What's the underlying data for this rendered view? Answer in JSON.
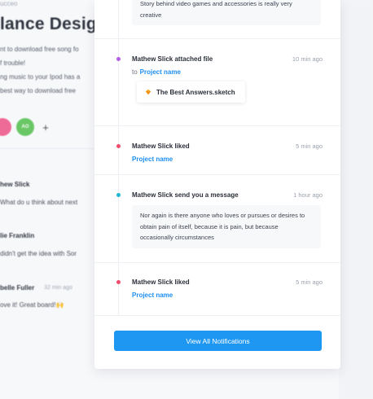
{
  "background_page": {
    "crumb": "ucceo",
    "title": "lance Design",
    "description_lines": [
      "nt to download free song fo",
      "f trouble!",
      "ng music to your Ipod has a",
      " best way to download free"
    ],
    "avatar_initials": "AO",
    "comments": [
      {
        "name": "hew Slick",
        "time": "",
        "text": "What do u think about next"
      },
      {
        "name": "lie Franklin",
        "time": "",
        "text": "didn't get the idea with Sor"
      },
      {
        "name": "belle Fuller",
        "time": "32 min ago",
        "text": "ove it! Great board!🙌"
      }
    ]
  },
  "notifications": {
    "top_quote": "Story behind video games and accessories is really very creative",
    "items": [
      {
        "title": "Mathew Slick attached file",
        "time": "10 min ago",
        "to": "to",
        "link": "Project name",
        "file": "The Best Answers.sketch",
        "dot_color": "#b45de6"
      },
      {
        "title": "Mathew Slick liked",
        "time": "5 min ago",
        "link": "Project name",
        "dot_color": "#f04b6a"
      },
      {
        "title": "Mathew Slick send you a message",
        "time": "1 hour ago",
        "quote": "Nor again is there anyone who loves or pursues or desires to obtain pain of itself, because it is pain, but because occasionally circumstances",
        "dot_color": "#1fb7d4"
      },
      {
        "title": "Mathew Slick liked",
        "time": "5 min ago",
        "link": "Project name",
        "dot_color": "#f04b6a"
      }
    ],
    "view_all_label": "View All Notifications"
  },
  "colors": {
    "accent": "#1e97f3",
    "link": "#1e8ef0"
  }
}
